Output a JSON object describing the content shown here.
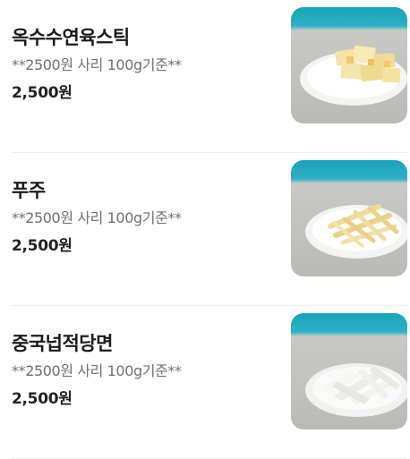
{
  "menu_items": [
    {
      "name": "옥수수연육스틱",
      "description": "**2500원 사리 100g기준**",
      "price": "2,500원",
      "image": "corn-fish-cake-sticks-on-plate"
    },
    {
      "name": "푸주",
      "description": "**2500원 사리 100g기준**",
      "price": "2,500원",
      "image": "dried-tofu-skin-on-plate"
    },
    {
      "name": "중국넙적당면",
      "description": "**2500원 사리 100g기준**",
      "price": "2,500원",
      "image": "wide-glass-noodles-on-plate"
    }
  ],
  "colors": {
    "name_text": "#1a1a1a",
    "description_text": "#707070",
    "price_text": "#222222",
    "divider": "#efefef",
    "photo_backdrop_teal": "#1c9fb5",
    "photo_table_gray": "#c9c9c5"
  }
}
